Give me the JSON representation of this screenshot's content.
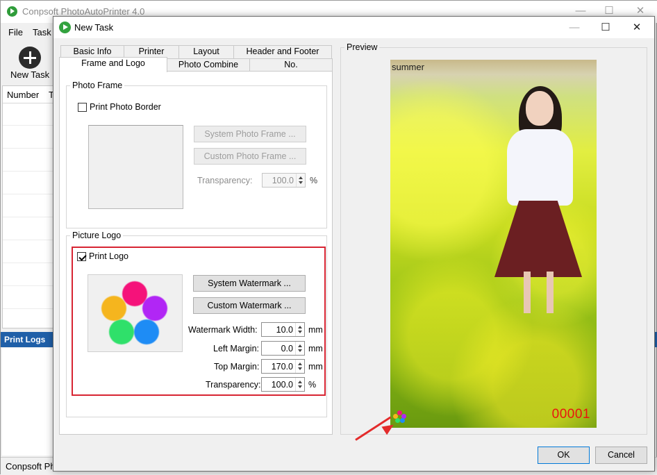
{
  "app": {
    "title": "Conpsoft PhotoAutoPrinter 4.0",
    "menu": [
      "File",
      "Task"
    ],
    "toolbar": {
      "new_task_label": "New Task"
    },
    "grid_headers": [
      "Number",
      "T"
    ],
    "print_logs_label": "Print Logs",
    "status_text": "Conpsoft Ph",
    "window_controls": {
      "minimize": "—",
      "maximize": "☐",
      "close": "✕"
    }
  },
  "dialog": {
    "title": "New Task",
    "window_controls": {
      "minimize": "—",
      "maximize": "☐",
      "close": "✕"
    },
    "tabs_row1": [
      "Basic Info",
      "Printer",
      "Layout",
      "Header and Footer"
    ],
    "tabs_row2": [
      "Frame and Logo",
      "Photo Combine",
      "No."
    ],
    "active_tab": "Frame and Logo",
    "photo_frame": {
      "group_label": "Photo Frame",
      "print_border_label": "Print Photo Border",
      "print_border_checked": false,
      "system_frame_button": "System Photo Frame ...",
      "custom_frame_button": "Custom Photo Frame ...",
      "transparency_label": "Transparency:",
      "transparency_value": "100.0",
      "transparency_unit": "%"
    },
    "picture_logo": {
      "group_label": "Picture Logo",
      "print_logo_label": "Print Logo",
      "print_logo_checked": true,
      "system_watermark_button": "System Watermark ...",
      "custom_watermark_button": "Custom Watermark ...",
      "watermark_width_label": "Watermark Width:",
      "watermark_width_value": "10.0",
      "left_margin_label": "Left Margin:",
      "left_margin_value": "0.0",
      "top_margin_label": "Top Margin:",
      "top_margin_value": "170.0",
      "transparency_label": "Transparency:",
      "transparency_value": "100.0",
      "unit_mm": "mm",
      "unit_percent": "%",
      "logo_colors": [
        "#f5127a",
        "#b126f5",
        "#1e8cf5",
        "#2fe06a",
        "#f5b51e"
      ]
    },
    "preview": {
      "group_label": "Preview",
      "caption": "summer",
      "number": "00001"
    },
    "ok_button": "OK",
    "cancel_button": "Cancel"
  },
  "colors": {
    "highlight": "#d72432",
    "number_red": "#e8150e",
    "print_logs_bar": "#1f5fa8",
    "arrow": "#e32b2b"
  }
}
